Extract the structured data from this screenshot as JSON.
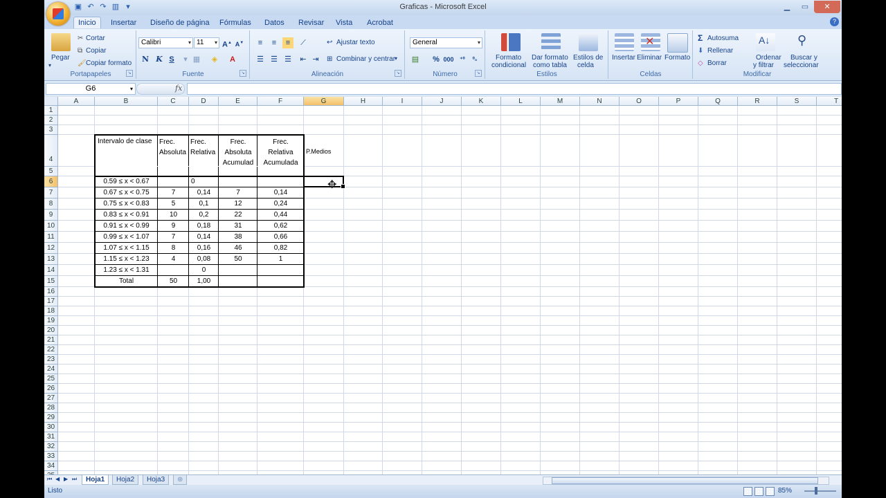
{
  "window": {
    "title": "Graficas - Microsoft Excel"
  },
  "tabs": [
    "Inicio",
    "Insertar",
    "Diseño de página",
    "Fórmulas",
    "Datos",
    "Revisar",
    "Vista",
    "Acrobat"
  ],
  "ribbon": {
    "portapapeles": {
      "label": "Portapapeles",
      "pegar": "Pegar",
      "cortar": "Cortar",
      "copiar": "Copiar",
      "copiar_formato": "Copiar formato"
    },
    "fuente": {
      "label": "Fuente",
      "font_name": "Calibri",
      "font_size": "11",
      "bold": "N",
      "italic": "K",
      "underline": "S"
    },
    "alineacion": {
      "label": "Alineación",
      "ajustar_texto": "Ajustar texto",
      "combinar": "Combinar y centrar"
    },
    "numero": {
      "label": "Número",
      "format": "General"
    },
    "estilos": {
      "label": "Estilos",
      "formato_condicional_1": "Formato",
      "formato_condicional_2": "condicional",
      "dar_formato_1": "Dar formato",
      "dar_formato_2": "como tabla",
      "estilos_celda_1": "Estilos de",
      "estilos_celda_2": "celda"
    },
    "celdas": {
      "label": "Celdas",
      "insertar": "Insertar",
      "eliminar": "Eliminar",
      "formato": "Formato"
    },
    "modificar": {
      "label": "Modificar",
      "autosuma": "Autosuma",
      "rellenar": "Rellenar",
      "borrar": "Borrar",
      "ordenar_1": "Ordenar",
      "ordenar_2": "y filtrar",
      "buscar_1": "Buscar y",
      "buscar_2": "seleccionar"
    }
  },
  "formula_bar": {
    "name_box": "G6",
    "fx": "fx",
    "content": ""
  },
  "columns": [
    "A",
    "B",
    "C",
    "D",
    "E",
    "F",
    "G",
    "H",
    "I",
    "J",
    "K",
    "L",
    "M",
    "N",
    "O",
    "P",
    "Q",
    "R",
    "S",
    "T"
  ],
  "rows": [
    "1",
    "2",
    "3",
    "4",
    "5",
    "6",
    "7",
    "8",
    "9",
    "10",
    "11",
    "12",
    "13",
    "14",
    "15",
    "16",
    "17",
    "18",
    "19",
    "20",
    "21",
    "22",
    "23",
    "24",
    "25",
    "26",
    "27",
    "28",
    "29",
    "30",
    "31",
    "32",
    "33",
    "34",
    "35"
  ],
  "table": {
    "headers": {
      "b": "Intervalo de clase",
      "c": [
        "Frec.",
        "Absoluta"
      ],
      "d": [
        "Frec.",
        "Relativa"
      ],
      "e": [
        "Frec.",
        "Absoluta",
        "Acumulad"
      ],
      "f": [
        "Frec.",
        "Relativa",
        "Acumulada"
      ],
      "g": "P.Medios"
    },
    "rows": [
      {
        "b": "0.59 ≤ x < 0.67",
        "c": "",
        "d": "0",
        "e": "",
        "f": ""
      },
      {
        "b": "0.67 ≤ x < 0.75",
        "c": "7",
        "d": "0,14",
        "e": "7",
        "f": "0,14"
      },
      {
        "b": "0.75 ≤ x < 0.83",
        "c": "5",
        "d": "0,1",
        "e": "12",
        "f": "0,24"
      },
      {
        "b": "0.83 ≤ x < 0.91",
        "c": "10",
        "d": "0,2",
        "e": "22",
        "f": "0,44"
      },
      {
        "b": "0.91 ≤ x < 0.99",
        "c": "9",
        "d": "0,18",
        "e": "31",
        "f": "0,62"
      },
      {
        "b": "0.99 ≤ x < 1.07",
        "c": "7",
        "d": "0,14",
        "e": "38",
        "f": "0,66"
      },
      {
        "b": "1.07 ≤ x < 1.15",
        "c": "8",
        "d": "0,16",
        "e": "46",
        "f": "0,82"
      },
      {
        "b": "1.15 ≤ x < 1.23",
        "c": "4",
        "d": "0,08",
        "e": "50",
        "f": "1"
      },
      {
        "b": "1.23 ≤ x < 1.31",
        "c": "",
        "d": "0",
        "e": "",
        "f": ""
      },
      {
        "b": "Total",
        "c": "50",
        "d": "1,00",
        "e": "",
        "f": ""
      }
    ]
  },
  "sheets": [
    "Hoja1",
    "Hoja2",
    "Hoja3"
  ],
  "status": {
    "ready": "Listo",
    "zoom": "85%"
  }
}
